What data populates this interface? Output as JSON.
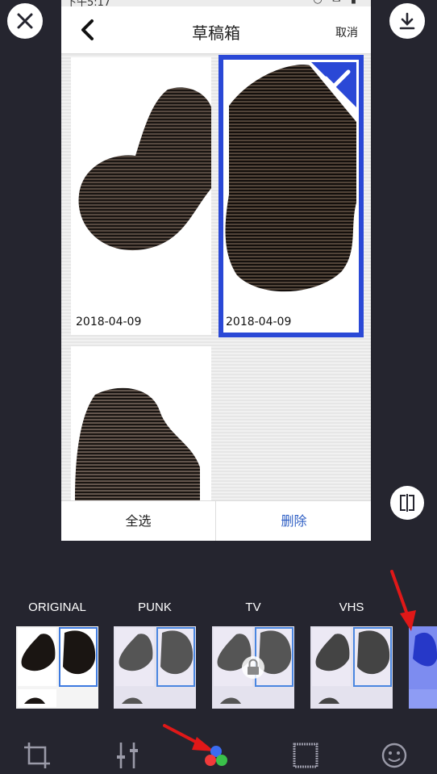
{
  "status_bar": {
    "time": "下午5:17",
    "icons": "◷ ✉ ▮"
  },
  "draft_screen": {
    "title": "草稿箱",
    "cancel_label": "取消",
    "drafts": [
      {
        "date": "2018-04-09",
        "selected": false
      },
      {
        "date": "2018-04-09",
        "selected": true
      },
      {
        "date": "",
        "selected": false
      }
    ],
    "select_all_label": "全选",
    "delete_label": "删除"
  },
  "filters": [
    {
      "label": "ORIGINAL",
      "locked": false
    },
    {
      "label": "PUNK",
      "locked": false
    },
    {
      "label": "TV",
      "locked": true
    },
    {
      "label": "VHS",
      "locked": false
    },
    {
      "label": "",
      "locked": false
    }
  ],
  "toolbar": [
    {
      "name": "crop-icon"
    },
    {
      "name": "adjust-icon"
    },
    {
      "name": "color-filter-icon"
    },
    {
      "name": "frame-icon"
    },
    {
      "name": "sticker-icon"
    }
  ],
  "colors": {
    "background": "#25252f",
    "selection": "#2a48d6",
    "delete_text": "#2f5fc4",
    "annotation_arrow": "#e01818"
  }
}
